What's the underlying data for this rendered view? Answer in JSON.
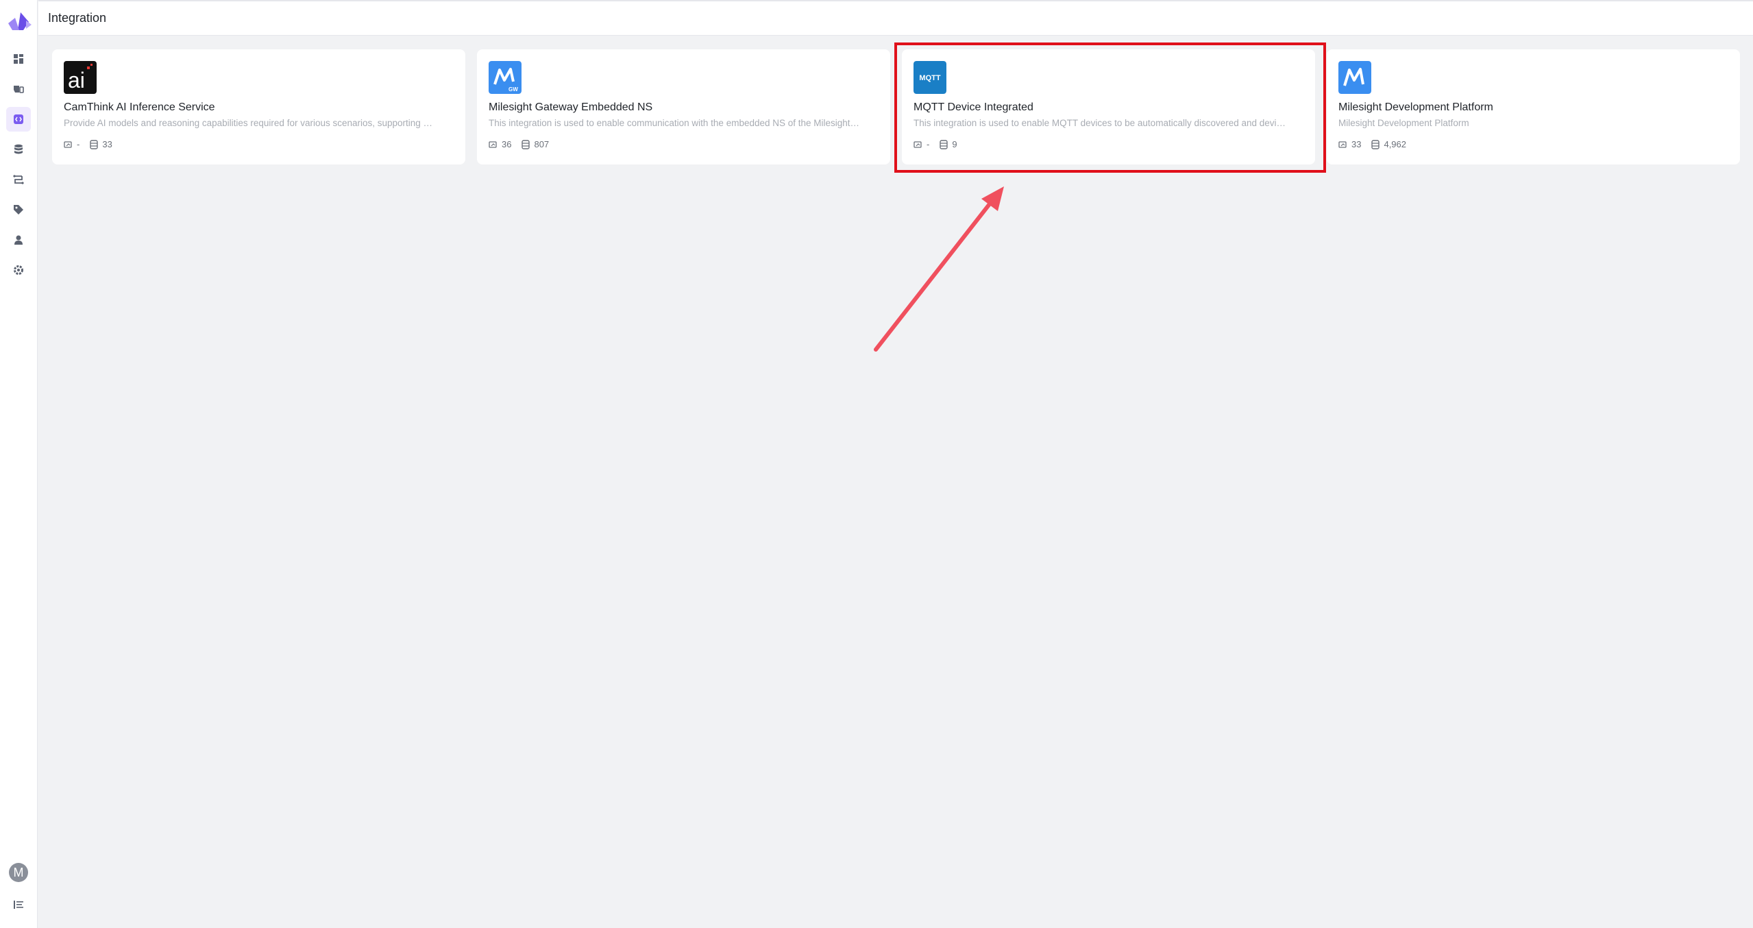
{
  "header": {
    "title": "Integration"
  },
  "sidebar": {
    "items": [
      {
        "name": "dashboard-icon"
      },
      {
        "name": "device-icon"
      },
      {
        "name": "integration-icon"
      },
      {
        "name": "entity-icon"
      },
      {
        "name": "workflow-icon"
      },
      {
        "name": "tag-icon"
      },
      {
        "name": "user-icon"
      },
      {
        "name": "settings-icon"
      }
    ],
    "avatar_letter": "M",
    "active_index": 2
  },
  "cards": [
    {
      "title": "CamThink AI Inference Service",
      "description": "Provide AI models and reasoning capabilities required for various scenarios, supporting …",
      "devices": "-",
      "entities": "33",
      "icon": "camthink-ai-logo"
    },
    {
      "title": "Milesight Gateway Embedded NS",
      "description": "This integration is used to enable communication with the embedded NS of the Milesight…",
      "devices": "36",
      "entities": "807",
      "icon": "milesight-gw-logo"
    },
    {
      "title": "MQTT Device Integrated",
      "description": "This integration is used to enable MQTT devices to be automatically discovered and devi…",
      "devices": "-",
      "entities": "9",
      "icon": "mqtt-logo",
      "icon_text": "MQTT"
    },
    {
      "title": "Milesight Development Platform",
      "description": "Milesight Development Platform",
      "devices": "33",
      "entities": "4,962",
      "icon": "milesight-logo"
    }
  ],
  "colors": {
    "accent": "#7b5cf0",
    "highlight": "#e0101a",
    "arrow": "#f0505e",
    "mqtt": "#1a7fc6",
    "milesight": "#3a8ef0"
  }
}
